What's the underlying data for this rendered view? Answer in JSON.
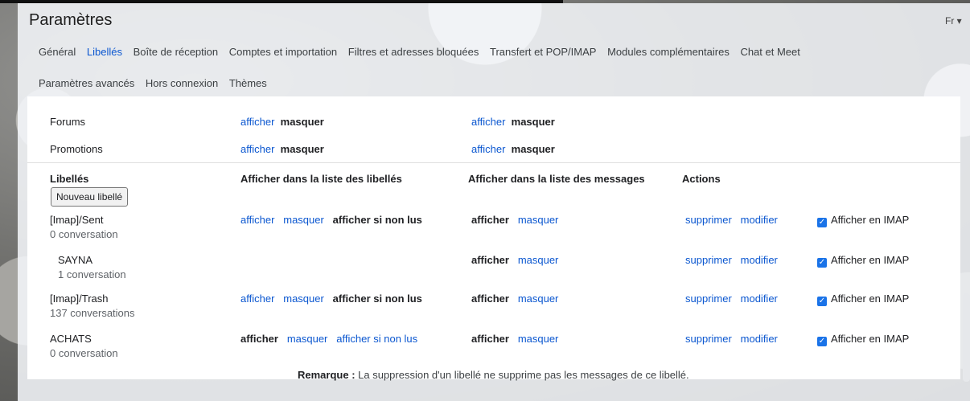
{
  "header": {
    "title": "Paramètres",
    "language_short": "Fr"
  },
  "tabs_row1": [
    {
      "label": "Général",
      "active": false
    },
    {
      "label": "Libellés",
      "active": true
    },
    {
      "label": "Boîte de réception",
      "active": false
    },
    {
      "label": "Comptes et importation",
      "active": false
    },
    {
      "label": "Filtres et adresses bloquées",
      "active": false
    },
    {
      "label": "Transfert et POP/IMAP",
      "active": false
    },
    {
      "label": "Modules complémentaires",
      "active": false
    },
    {
      "label": "Chat et Meet",
      "active": false
    }
  ],
  "tabs_row2": [
    {
      "label": "Paramètres avancés",
      "active": false
    },
    {
      "label": "Hors connexion",
      "active": false
    },
    {
      "label": "Thèmes",
      "active": false
    }
  ],
  "categories": [
    {
      "name": "Forums",
      "show_list": "afficher",
      "hide_list": "masquer",
      "show_msgs": "afficher",
      "hide_msgs": "masquer"
    },
    {
      "name": "Promotions",
      "show_list": "afficher",
      "hide_list": "masquer",
      "show_msgs": "afficher",
      "hide_msgs": "masquer"
    }
  ],
  "labels_section": {
    "col_labels": "Libellés",
    "col_show_in_labels_list": "Afficher dans la liste des libellés",
    "col_show_in_message_list": "Afficher dans la liste des messages",
    "col_actions": "Actions",
    "new_label_button": "Nouveau libellé",
    "rows": [
      {
        "name": "[Imap]/Sent",
        "count": "0 conversation",
        "list_a": "afficher",
        "list_b": "masquer",
        "list_c": "afficher si non lus",
        "msg_a": "afficher",
        "msg_b": "masquer",
        "del": "supprimer",
        "edit": "modifier",
        "imap": "Afficher en IMAP"
      },
      {
        "name": "SAYNA",
        "count": "1 conversation",
        "list_a": "",
        "list_b": "",
        "list_c": "",
        "msg_a": "afficher",
        "msg_b": "masquer",
        "del": "supprimer",
        "edit": "modifier",
        "imap": "Afficher en IMAP"
      },
      {
        "name": "[Imap]/Trash",
        "count": "137 conversations",
        "list_a": "afficher",
        "list_b": "masquer",
        "list_c": "afficher si non lus",
        "msg_a": "afficher",
        "msg_b": "masquer",
        "del": "supprimer",
        "edit": "modifier",
        "imap": "Afficher en IMAP"
      },
      {
        "name": "ACHATS",
        "count": "0 conversation",
        "list_a": "afficher",
        "list_b": "masquer",
        "list_c": "afficher si non lus",
        "msg_a": "afficher",
        "msg_b": "masquer",
        "del": "supprimer",
        "edit": "modifier",
        "imap": "Afficher en IMAP"
      }
    ],
    "note_bold": "Remarque :",
    "note_text": " La suppression d'un libellé ne supprime pas les messages de ce libellé."
  },
  "colors": {
    "link": "#0b57d0",
    "checkbox": "#1a73e8"
  }
}
